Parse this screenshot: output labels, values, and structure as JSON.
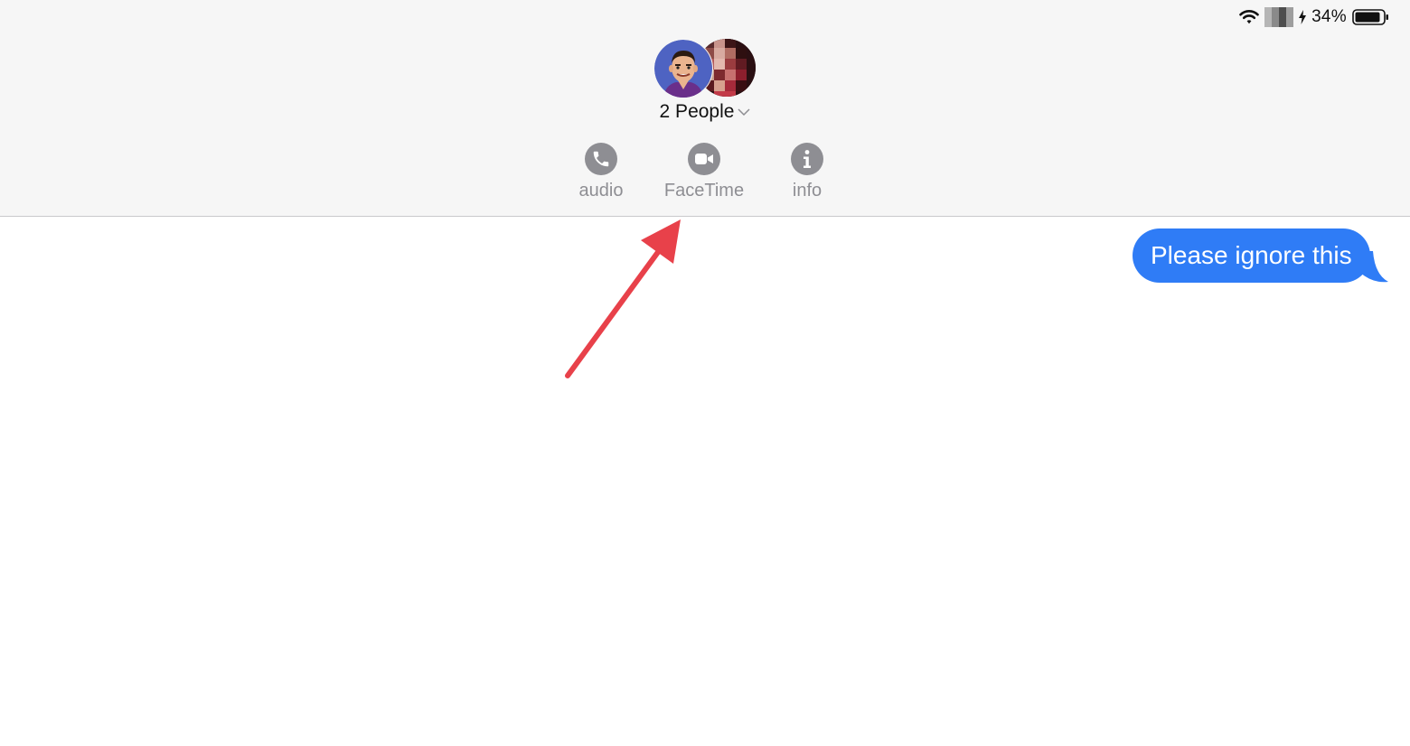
{
  "status_bar": {
    "battery_percent": "34%",
    "icons": [
      "wifi-icon",
      "battery-icon"
    ]
  },
  "conversation": {
    "title": "2 People",
    "participant_count": 2,
    "avatars": [
      "avatar-cartoon-man",
      "avatar-pixelated"
    ]
  },
  "actions": {
    "audio_label": "audio",
    "facetime_label": "FaceTime",
    "info_label": "info"
  },
  "messages": [
    {
      "direction": "sent",
      "text": "Please ignore this"
    }
  ],
  "colors": {
    "header_bg": "#f6f6f6",
    "bubble_blue": "#2f7cf6",
    "action_gray": "#8e8e93",
    "annotation_arrow": "#e8414a"
  }
}
